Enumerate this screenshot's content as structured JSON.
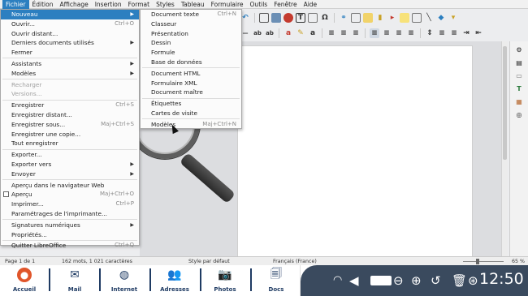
{
  "menubar": {
    "items": [
      "Fichier",
      "Édition",
      "Affichage",
      "Insertion",
      "Format",
      "Styles",
      "Tableau",
      "Formulaire",
      "Outils",
      "Fenêtre",
      "Aide"
    ]
  },
  "file_menu": {
    "items": [
      {
        "label": "Nouveau",
        "shortcut": "",
        "submenu": true
      },
      {
        "label": "Ouvrir...",
        "shortcut": "Ctrl+O"
      },
      {
        "label": "Ouvrir distant...",
        "shortcut": ""
      },
      {
        "label": "Derniers documents utilisés",
        "shortcut": "",
        "submenu": true
      },
      {
        "label": "Fermer",
        "shortcut": ""
      },
      {
        "label": "Assistants",
        "shortcut": "",
        "submenu": true
      },
      {
        "label": "Modèles",
        "shortcut": "",
        "submenu": true
      },
      {
        "label": "Recharger",
        "shortcut": ""
      },
      {
        "label": "Versions...",
        "shortcut": ""
      },
      {
        "label": "Enregistrer",
        "shortcut": "Ctrl+S"
      },
      {
        "label": "Enregistrer distant...",
        "shortcut": ""
      },
      {
        "label": "Enregistrer sous...",
        "shortcut": "Maj+Ctrl+S"
      },
      {
        "label": "Enregistrer une copie...",
        "shortcut": ""
      },
      {
        "label": "Tout enregistrer",
        "shortcut": ""
      },
      {
        "label": "Exporter...",
        "shortcut": ""
      },
      {
        "label": "Exporter vers",
        "shortcut": "",
        "submenu": true
      },
      {
        "label": "Envoyer",
        "shortcut": "",
        "submenu": true
      },
      {
        "label": "Aperçu dans le navigateur Web",
        "shortcut": ""
      },
      {
        "label": "Aperçu",
        "shortcut": "Maj+Ctrl+O"
      },
      {
        "label": "Imprimer...",
        "shortcut": "Ctrl+P"
      },
      {
        "label": "Paramétrages de l'imprimante...",
        "shortcut": ""
      },
      {
        "label": "Signatures numériques",
        "shortcut": "",
        "submenu": true
      },
      {
        "label": "Propriétés...",
        "shortcut": ""
      },
      {
        "label": "Quitter LibreOffice",
        "shortcut": "Ctrl+Q"
      }
    ]
  },
  "new_submenu": {
    "items": [
      {
        "label": "Document texte",
        "shortcut": "Ctrl+N"
      },
      {
        "label": "Classeur",
        "shortcut": ""
      },
      {
        "label": "Présentation",
        "shortcut": ""
      },
      {
        "label": "Dessin",
        "shortcut": ""
      },
      {
        "label": "Formule",
        "shortcut": ""
      },
      {
        "label": "Base de données",
        "shortcut": ""
      },
      {
        "label": "Document HTML",
        "shortcut": ""
      },
      {
        "label": "Formulaire XML",
        "shortcut": ""
      },
      {
        "label": "Document maître",
        "shortcut": ""
      },
      {
        "label": "Étiquettes",
        "shortcut": ""
      },
      {
        "label": "Cartes de visite",
        "shortcut": ""
      },
      {
        "label": "Modèles",
        "shortcut": "Maj+Ctrl+N"
      }
    ]
  },
  "statusbar": {
    "page": "Page 1 de 1",
    "words": "162 mots, 1 021 caractères",
    "style": "Style par défaut",
    "language": "Français (France)",
    "zoom": "65 %"
  },
  "dock": {
    "items": [
      {
        "label": "Accueil",
        "icon": "home-icon"
      },
      {
        "label": "Mail",
        "icon": "mail-icon"
      },
      {
        "label": "Internet",
        "icon": "globe-icon"
      },
      {
        "label": "Adresses",
        "icon": "contacts-icon"
      },
      {
        "label": "Photos",
        "icon": "camera-icon"
      },
      {
        "label": "Docs",
        "icon": "document-icon"
      }
    ]
  },
  "tray": {
    "clock": "12:50"
  },
  "colors": {
    "menu_highlight": "#2c7fc0",
    "dock_text": "#1f3b63",
    "tray_bg": "#3a4a5e"
  }
}
